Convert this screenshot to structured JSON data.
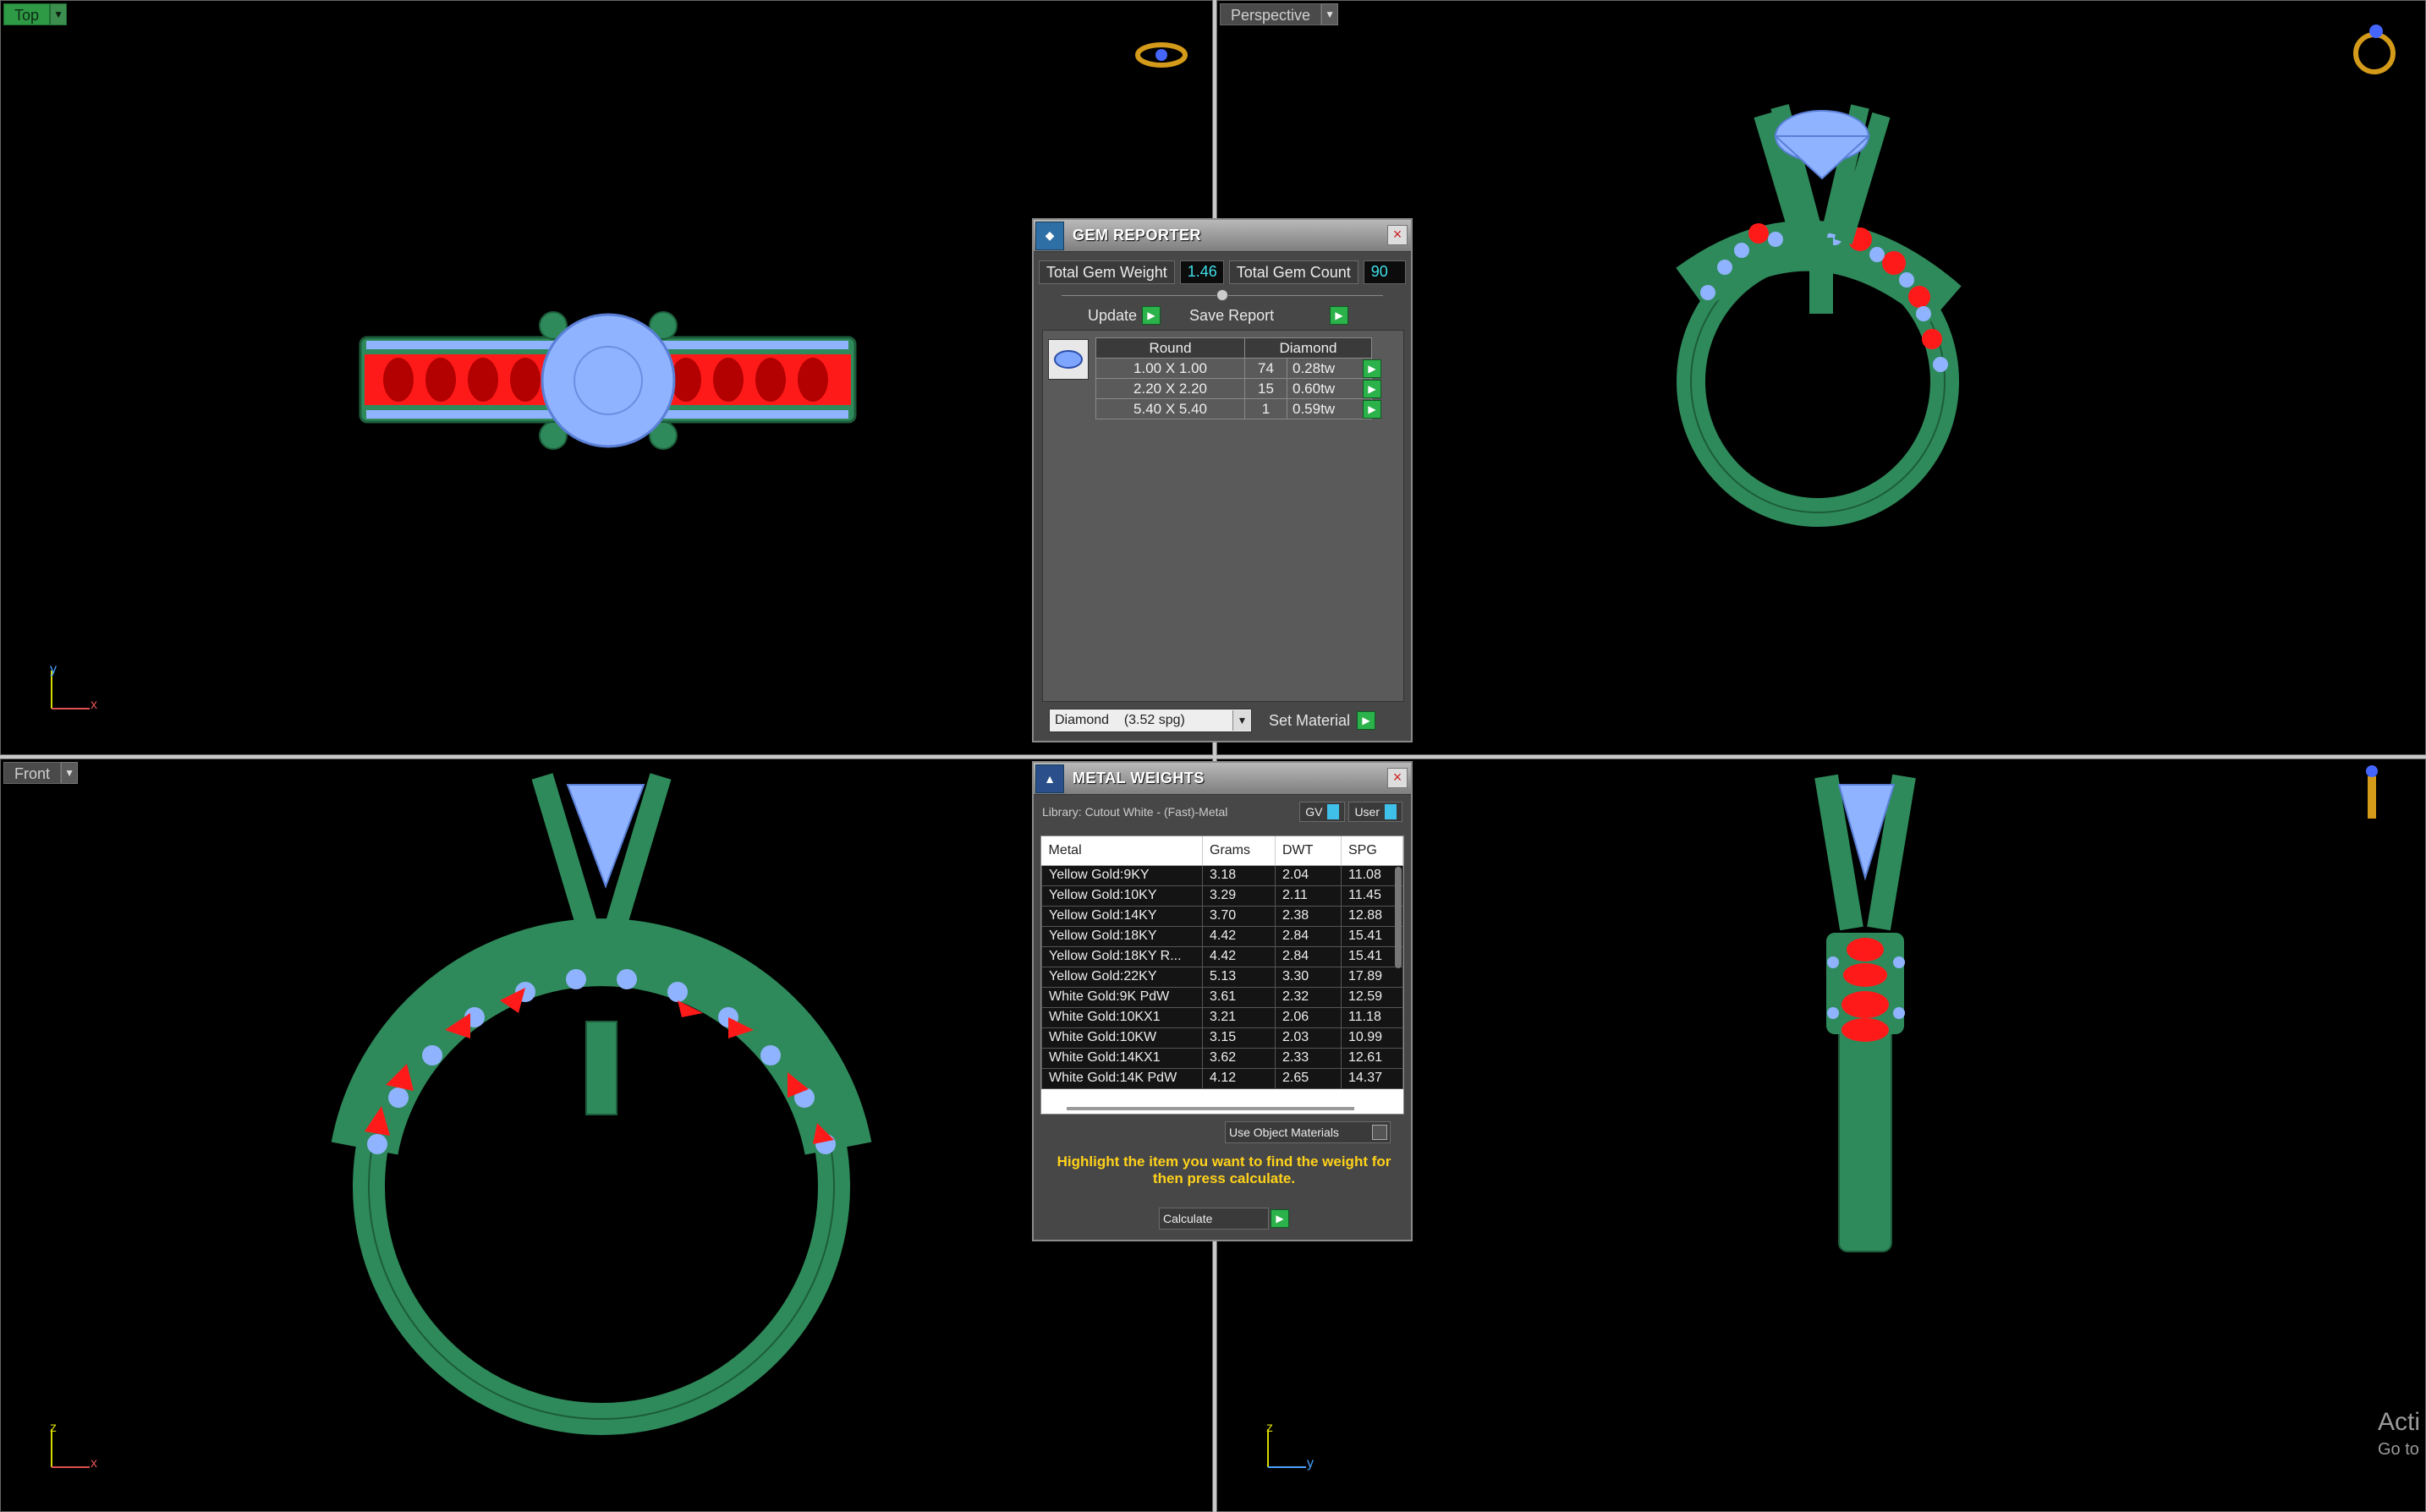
{
  "viewports": {
    "top": {
      "label": "Top",
      "axis1": "y",
      "axis2": "x"
    },
    "perspective": {
      "label": "Perspective"
    },
    "front": {
      "label": "Front",
      "axis1": "z",
      "axis2": "x"
    },
    "right": {
      "axis1": "z",
      "axis2": "y"
    }
  },
  "gem_reporter": {
    "title": "GEM REPORTER",
    "total_weight_label": "Total Gem Weight",
    "total_weight": "1.46",
    "total_count_label": "Total Gem Count",
    "total_count": "90",
    "update_label": "Update",
    "save_label": "Save Report",
    "col_shape": "Round",
    "col_material": "Diamond",
    "rows": [
      {
        "size": "1.00 X 1.00",
        "count": "74",
        "weight": "0.28tw"
      },
      {
        "size": "2.20 X 2.20",
        "count": "15",
        "weight": "0.60tw"
      },
      {
        "size": "5.40 X 5.40",
        "count": "1",
        "weight": "0.59tw"
      }
    ],
    "material_select": "Diamond    (3.52 spg)",
    "set_material_label": "Set Material"
  },
  "metal_weights": {
    "title": "METAL WEIGHTS",
    "library": "Library: Cutout White - (Fast)-Metal",
    "gv_label": "GV",
    "user_label": "User",
    "columns": [
      "Metal",
      "Grams",
      "DWT",
      "SPG"
    ],
    "rows": [
      [
        "Yellow Gold:9KY",
        "3.18",
        "2.04",
        "11.08"
      ],
      [
        "Yellow Gold:10KY",
        "3.29",
        "2.11",
        "11.45"
      ],
      [
        "Yellow Gold:14KY",
        "3.70",
        "2.38",
        "12.88"
      ],
      [
        "Yellow Gold:18KY",
        "4.42",
        "2.84",
        "15.41"
      ],
      [
        "Yellow Gold:18KY R...",
        "4.42",
        "2.84",
        "15.41"
      ],
      [
        "Yellow Gold:22KY",
        "5.13",
        "3.30",
        "17.89"
      ],
      [
        "White Gold:9K PdW",
        "3.61",
        "2.32",
        "12.59"
      ],
      [
        "White Gold:10KX1",
        "3.21",
        "2.06",
        "11.18"
      ],
      [
        "White Gold:10KW",
        "3.15",
        "2.03",
        "10.99"
      ],
      [
        "White Gold:14KX1",
        "3.62",
        "2.33",
        "12.61"
      ],
      [
        "White Gold:14K PdW",
        "4.12",
        "2.65",
        "14.37"
      ]
    ],
    "use_object_label": "Use Object Materials",
    "hint": "Highlight the item you want to find the weight for then press calculate.",
    "calculate_label": "Calculate"
  },
  "watermark": {
    "line1": "Acti",
    "line2": "Go to"
  },
  "colors": {
    "metal": "#2e8a5a",
    "gem": "#8fb3ff",
    "red_gem": "#ff1a1a",
    "viewport_label": "#2f9a45"
  }
}
